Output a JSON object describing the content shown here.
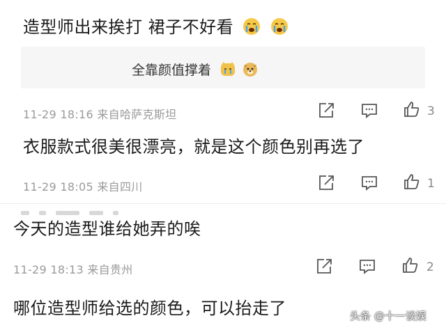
{
  "comments": [
    {
      "text": "造型师出来挨打 裙子不好看",
      "emojis": [
        "crying-face-emoji",
        "crying-face-emoji"
      ],
      "reply": {
        "text": "全靠颜值撑着",
        "emojis": [
          "crying-cat-emoji",
          "doge-emoji"
        ]
      },
      "meta": "11-29 18:16 来自哈萨克斯坦",
      "likes": "3"
    },
    {
      "text": "衣服款式很美很漂亮，就是这个颜色别再选了",
      "meta": "11-29 18:05 来自四川",
      "likes": "1"
    },
    {
      "text": "今天的造型谁给她弄的唉",
      "meta": "11-29 18:13 来自贵州",
      "likes": "2"
    },
    {
      "text": "哪位造型师给选的颜色，可以抬走了"
    }
  ],
  "icons": {
    "share": "share-icon",
    "reply": "comment-icon",
    "like": "thumbs-up-icon"
  },
  "colors": {
    "text": "#1a1a1a",
    "meta": "#9a9a9a",
    "reply_bg": "#f6f6f6",
    "emoji": "#f7c948"
  },
  "watermark": "头条 @十一谈娱"
}
